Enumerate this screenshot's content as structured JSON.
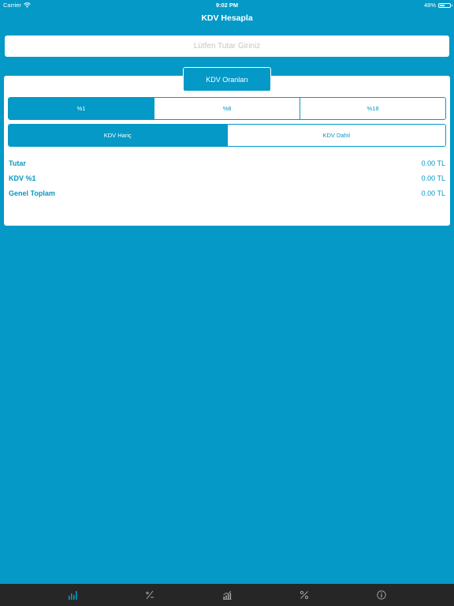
{
  "status_bar": {
    "carrier": "Carrier",
    "time": "9:02 PM",
    "battery": "48%",
    "battery_level": 0.48
  },
  "nav": {
    "title": "KDV Hesapla"
  },
  "amount_input": {
    "placeholder": "Lütfen Tutar Giriniz",
    "value": ""
  },
  "rates_tab": {
    "label": "KDV Oranları"
  },
  "rate_options": [
    {
      "label": "%1",
      "selected": true
    },
    {
      "label": "%8",
      "selected": false
    },
    {
      "label": "%18",
      "selected": false
    }
  ],
  "mode_options": [
    {
      "label": "KDV Hariç",
      "selected": true
    },
    {
      "label": "KDV Dahil",
      "selected": false
    }
  ],
  "results": [
    {
      "label": "Tutar",
      "value": "0.00 TL"
    },
    {
      "label": "KDV %1",
      "value": "0.00 TL"
    },
    {
      "label": "Genel Toplam",
      "value": "0.00 TL"
    }
  ],
  "tab_bar": {
    "items": [
      {
        "icon": "bar-chart-icon",
        "active": true
      },
      {
        "icon": "plus-minus-icon",
        "active": false
      },
      {
        "icon": "growth-chart-icon",
        "active": false
      },
      {
        "icon": "percent-icon",
        "active": false
      },
      {
        "icon": "info-icon",
        "active": false
      }
    ]
  },
  "colors": {
    "background": "#0499c6",
    "accent": "#0499c6",
    "card": "#ffffff",
    "tab_bar": "#262626",
    "tab_active": "#0499c6",
    "tab_inactive": "#a8a8a8"
  }
}
